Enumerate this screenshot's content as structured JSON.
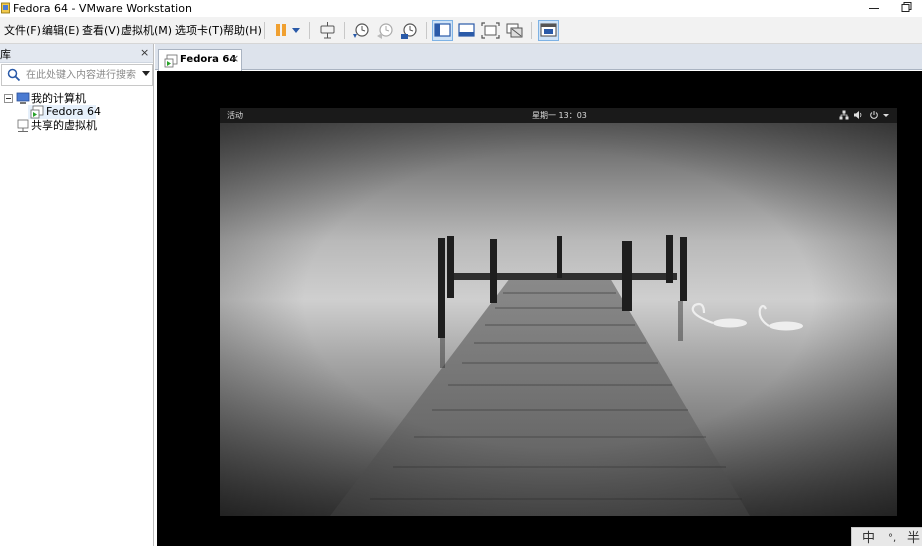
{
  "window": {
    "title": "Fedora 64 - VMware Workstation"
  },
  "menu": {
    "items": [
      {
        "id": "file",
        "label": "文件(F)"
      },
      {
        "id": "edit",
        "label": "编辑(E)"
      },
      {
        "id": "view",
        "label": "查看(V)"
      },
      {
        "id": "vm",
        "label": "虚拟机(M)"
      },
      {
        "id": "tabs",
        "label": "选项卡(T)"
      },
      {
        "id": "help",
        "label": "帮助(H)"
      }
    ]
  },
  "toolbar": {
    "icons": [
      "pause-icon",
      "dropdown-icon",
      "send-ctrl-alt-del-icon",
      "snapshot-take-icon",
      "snapshot-revert-icon",
      "snapshot-manager-icon",
      "show-library-icon",
      "thumbnail-bar-icon",
      "full-screen-icon",
      "unity-icon",
      "console-view-icon"
    ]
  },
  "library": {
    "title": "库",
    "close_label": "×",
    "search_placeholder": "在此处键入内容进行搜索",
    "tree": {
      "root_label": "我的计算机",
      "vm_label": "Fedora 64",
      "shared_label": "共享的虚拟机"
    }
  },
  "tab": {
    "label": "Fedora 64",
    "close_label": "×"
  },
  "guest": {
    "activities": "活动",
    "clock": "星期一 13：03"
  },
  "ime": {
    "lang": "中",
    "punct": "°,",
    "width": "半"
  },
  "colors": {
    "accent": "#3c8ede",
    "tab_strip": "#dde3ec",
    "console_bg": "#000000",
    "pause_orange": "#f0a030"
  }
}
